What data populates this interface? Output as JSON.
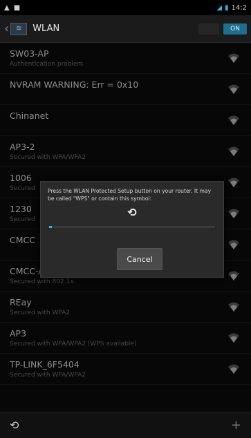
{
  "status_bar": {
    "time": "14:2"
  },
  "action_bar": {
    "title": "WLAN",
    "toggle_label": "ON"
  },
  "networks": [
    {
      "ssid": "SW03-AP",
      "subtitle": "Authentication problem"
    },
    {
      "ssid": "NVRAM WARNING: Err = 0x10",
      "subtitle": ""
    },
    {
      "ssid": "Chinanet",
      "subtitle": ""
    },
    {
      "ssid": "AP3-2",
      "subtitle": "Secured with WPA/WPA2"
    },
    {
      "ssid": "1006",
      "subtitle": "Secured"
    },
    {
      "ssid": "1230",
      "subtitle": "Secured"
    },
    {
      "ssid": "CMCC",
      "subtitle": ""
    },
    {
      "ssid": "CMCC-AUTO",
      "subtitle": "Secured with 802.1x"
    },
    {
      "ssid": "REay",
      "subtitle": "Secured with WPA2"
    },
    {
      "ssid": "AP3",
      "subtitle": "Secured with WPA/WPA2 (WPS available)"
    },
    {
      "ssid": "TP-LINK_6F5404",
      "subtitle": "Secured with WPA/WPA2"
    }
  ],
  "dialog": {
    "message": "Press the WLAN Protected Setup button on your router. It may be called \"WPS\" or contain this symbol:",
    "progress": 0.0,
    "cancel_label": "Cancel"
  },
  "icons": {
    "wifi": "wifi-signal-icon",
    "wps": "wps-icon",
    "add": "add-network-icon"
  },
  "colors": {
    "accent": "#33b5e5"
  }
}
